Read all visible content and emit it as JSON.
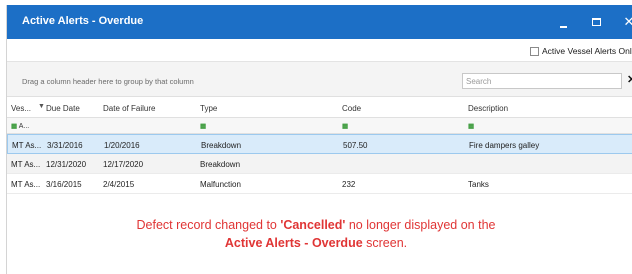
{
  "window": {
    "title": "Active Alerts - Overdue",
    "minimize_glyph": "_",
    "close_glyph": "✕"
  },
  "options": {
    "active_vessel_label": "Active Vessel Alerts Onl",
    "active_vessel_checked": false
  },
  "toolbar": {
    "group_hint": "Drag a column header here to group by that column",
    "search_placeholder": "Search",
    "search_clear": "✕"
  },
  "grid": {
    "columns": [
      "Ves...",
      "Due Date",
      "Date of Failure",
      "Type",
      "Code",
      "Description"
    ],
    "filter": {
      "icon": "filter-icon",
      "vessel_value": "A...",
      "glyph": "▪"
    },
    "rows": [
      {
        "vessel": "MT As...",
        "due": "3/31/2016",
        "failure": "1/20/2016",
        "type": "Breakdown",
        "code": "507.50",
        "description": "Fire dampers galley",
        "selected": true
      },
      {
        "vessel": "MT As...",
        "due": "12/31/2020",
        "failure": "12/17/2020",
        "type": "Breakdown",
        "code": "",
        "description": "",
        "selected": false
      },
      {
        "vessel": "MT As...",
        "due": "3/16/2015",
        "failure": "2/4/2015",
        "type": "Malfunction",
        "code": "232",
        "description": "Tanks",
        "selected": false
      }
    ]
  },
  "annotation": {
    "line1_prefix": "Defect record changed to ",
    "line1_bold": "'Cancelled'",
    "line1_suffix": " no longer displayed on the",
    "line2_bold": "Active Alerts - Overdue",
    "line2_suffix": " screen."
  },
  "colors": {
    "titlebar": "#1c6fc6",
    "selected_row": "#d9ebfa",
    "annotation": "#e03535"
  }
}
